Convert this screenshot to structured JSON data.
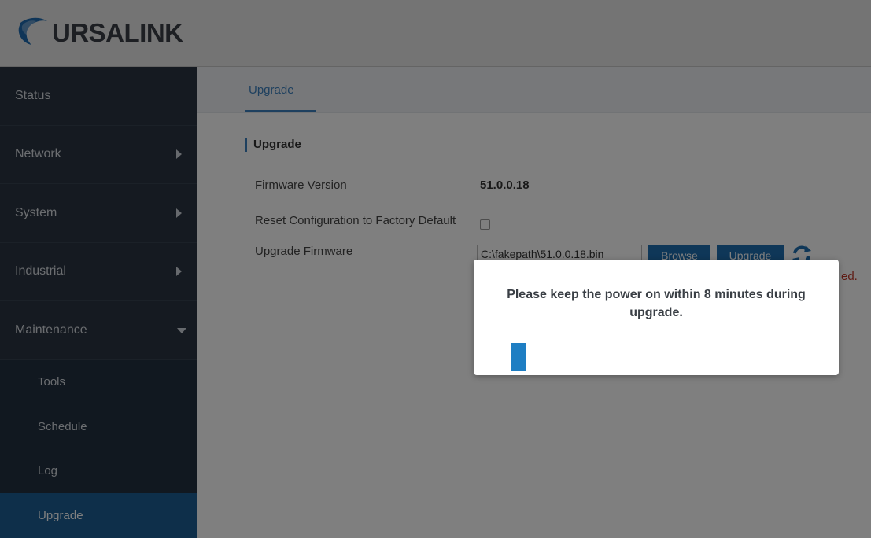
{
  "header": {
    "logo_text": "URSALINK",
    "logo_icon": "ursalink-logo-icon"
  },
  "sidebar": {
    "items": [
      {
        "label": "Status",
        "arrow": "none"
      },
      {
        "label": "Network",
        "arrow": "right"
      },
      {
        "label": "System",
        "arrow": "right"
      },
      {
        "label": "Industrial",
        "arrow": "right"
      },
      {
        "label": "Maintenance",
        "arrow": "down"
      }
    ],
    "subitems": [
      {
        "label": "Tools",
        "active": false
      },
      {
        "label": "Schedule",
        "active": false
      },
      {
        "label": "Log",
        "active": false
      },
      {
        "label": "Upgrade",
        "active": true
      }
    ]
  },
  "main": {
    "tab": "Upgrade",
    "section_title": "Upgrade",
    "firmware_version_label": "Firmware Version",
    "firmware_version_value": "51.0.0.18",
    "reset_label": "Reset Configuration to Factory Default",
    "reset_checked": false,
    "upgrade_firmware_label": "Upgrade Firmware",
    "file_path": "C:\\fakepath\\51.0.0.18.bin",
    "browse_button": "Browse",
    "upgrade_button": "Upgrade",
    "refresh_icon": "refresh-icon",
    "note_fragment": "ed."
  },
  "dialog": {
    "message": "Please keep the power on within 8 minutes during upgrade.",
    "progress_fraction": 0.04
  },
  "colors": {
    "sidebar_bg": "#2b3542",
    "active_item": "#1d5f94",
    "accent": "#3d80bf",
    "button": "#1e6fb0",
    "progress": "#1e7ec3"
  }
}
